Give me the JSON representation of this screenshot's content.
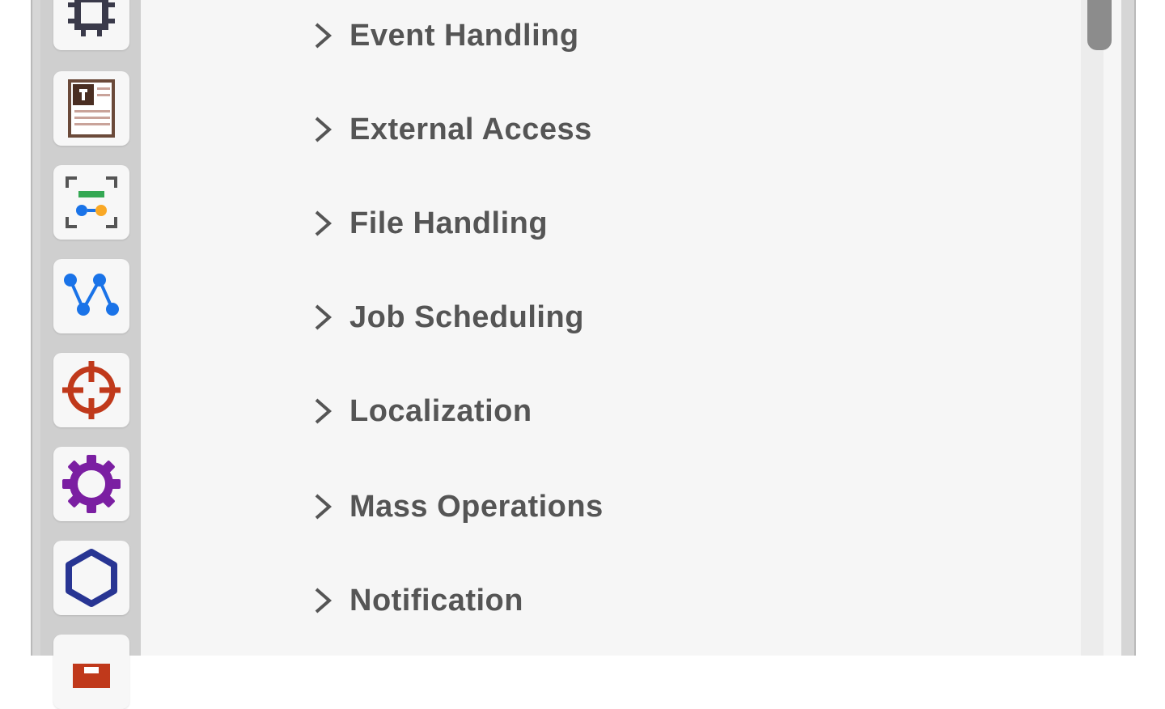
{
  "rail": {
    "items": [
      {
        "icon": "chip-icon",
        "color": "#3a3a4a"
      },
      {
        "icon": "document-template-icon",
        "color": "#5a3b2c"
      },
      {
        "icon": "scan-flow-icon",
        "color": "#1a73e8"
      },
      {
        "icon": "network-nodes-icon",
        "color": "#1a73e8"
      },
      {
        "icon": "crosshair-icon",
        "color": "#c0391b"
      },
      {
        "icon": "gear-icon",
        "color": "#7b1fa2"
      },
      {
        "icon": "hexagon-icon",
        "color": "#283593"
      },
      {
        "icon": "red-folder-icon",
        "color": "#c0391b"
      }
    ]
  },
  "list": {
    "items": [
      {
        "label": "Event Handling"
      },
      {
        "label": "External Access"
      },
      {
        "label": "File Handling"
      },
      {
        "label": "Job Scheduling"
      },
      {
        "label": "Localization"
      },
      {
        "label": "Mass Operations"
      },
      {
        "label": "Notification"
      }
    ]
  }
}
